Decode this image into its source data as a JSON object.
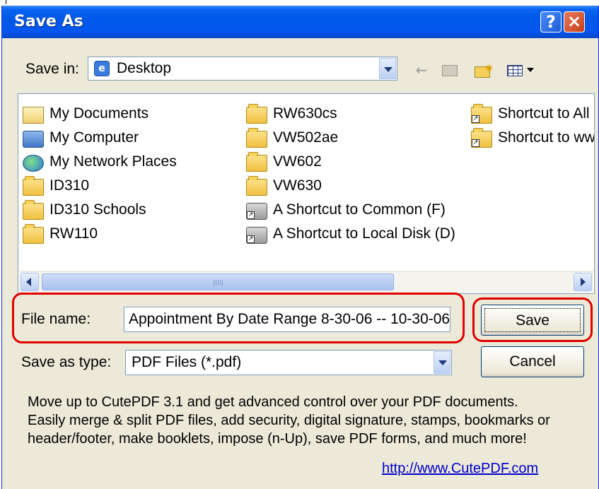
{
  "dialog": {
    "title": "Save As"
  },
  "title_buttons": {
    "help": "?",
    "close": "×"
  },
  "save_in": {
    "label": "Save in:",
    "value": "Desktop"
  },
  "toolbar": {
    "back": "←"
  },
  "files": [
    {
      "label": "My Documents",
      "icon": "my-documents-icon"
    },
    {
      "label": "My Computer",
      "icon": "my-computer-icon"
    },
    {
      "label": "My Network Places",
      "icon": "network-places-icon"
    },
    {
      "label": "ID310",
      "icon": "folder-icon"
    },
    {
      "label": "ID310 Schools",
      "icon": "folder-icon"
    },
    {
      "label": "RW110",
      "icon": "folder-icon"
    },
    {
      "label": "RW630cs",
      "icon": "folder-icon"
    },
    {
      "label": "VW502ae",
      "icon": "folder-icon"
    },
    {
      "label": "VW602",
      "icon": "folder-icon"
    },
    {
      "label": "VW630",
      "icon": "folder-icon"
    },
    {
      "label": "A Shortcut to Common (F)",
      "icon": "network-drive-shortcut-icon"
    },
    {
      "label": "A Shortcut to Local Disk (D)",
      "icon": "drive-shortcut-icon"
    },
    {
      "label": "Shortcut to All",
      "icon": "folder-shortcut-icon"
    },
    {
      "label": "Shortcut to ww",
      "icon": "folder-shortcut-icon"
    }
  ],
  "file_name": {
    "label": "File name:",
    "value": "Appointment By Date Range 8-30-06 -- 10-30-06"
  },
  "save_as_type": {
    "label": "Save as type:",
    "value": "PDF Files (*.pdf)"
  },
  "buttons": {
    "save": "Save",
    "cancel": "Cancel"
  },
  "promo": {
    "lines": [
      "Move up to CutePDF 3.1 and get advanced control over your PDF documents.",
      "Easily merge & split PDF files, add security, digital signature, stamps, bookmarks or",
      "header/footer, make booklets, impose (n-Up), save PDF forms, and much more!"
    ],
    "link": "http://www.CutePDF.com"
  },
  "colors": {
    "highlight": "#e00000",
    "titlebar": "#0058e6",
    "dialog_bg": "#ece9d8",
    "link": "#0000cc"
  }
}
